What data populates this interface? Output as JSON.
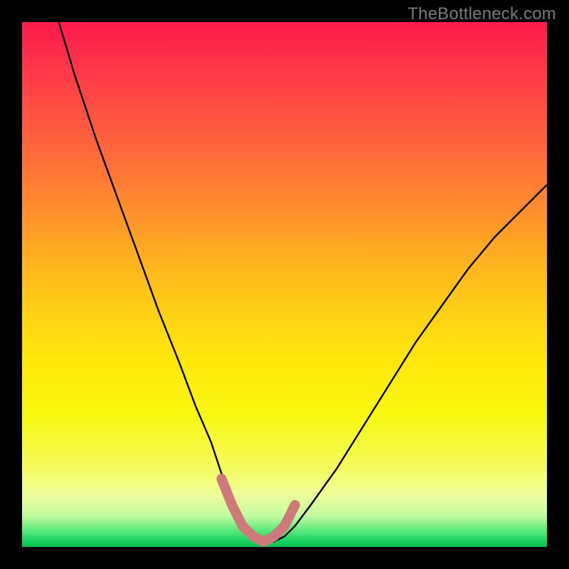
{
  "watermark": {
    "text": "TheBottleneck.com"
  },
  "chart_data": {
    "type": "line",
    "title": "",
    "xlabel": "",
    "ylabel": "",
    "xlim": [
      0,
      100
    ],
    "ylim": [
      0,
      100
    ],
    "gradient_legend": [
      "red (high bottleneck)",
      "yellow (medium)",
      "green (low bottleneck)"
    ],
    "series": [
      {
        "name": "bottleneck-curve",
        "color": "#000000",
        "x": [
          7,
          10,
          14,
          18,
          22,
          26,
          30,
          33,
          36,
          38,
          40,
          42,
          44,
          46,
          48,
          50,
          52,
          55,
          60,
          65,
          70,
          75,
          80,
          85,
          90,
          95,
          100
        ],
        "values": [
          100,
          90,
          78,
          67,
          56,
          45,
          35,
          27,
          20,
          14,
          9,
          5,
          2,
          1,
          1,
          2,
          4,
          8,
          15,
          23,
          31,
          39,
          46,
          53,
          59,
          64,
          69
        ]
      },
      {
        "name": "fit-region-highlight",
        "color": "#d57a7a",
        "x": [
          38,
          40,
          42,
          44,
          46,
          48,
          50,
          52
        ],
        "values": [
          13,
          8,
          4,
          2,
          1,
          2,
          4,
          8
        ]
      }
    ]
  }
}
